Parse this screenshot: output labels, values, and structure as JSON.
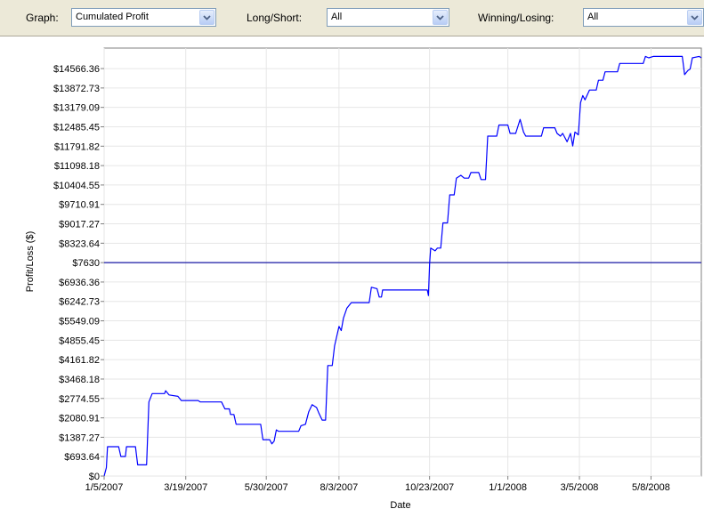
{
  "toolbar": {
    "graph_label": "Graph:",
    "graph_value": "Cumulated Profit",
    "longshort_label": "Long/Short:",
    "longshort_value": "All",
    "winlose_label": "Winning/Losing:",
    "winlose_value": "All",
    "dropdown_icon": "chevron-down-icon"
  },
  "chart_data": {
    "type": "line",
    "xlabel": "Date",
    "ylabel": "Profit/Loss ($)",
    "y_ticks": [
      "$0",
      "$693.64",
      "$1387.27",
      "$2080.91",
      "$2774.55",
      "$3468.18",
      "$4161.82",
      "$4855.45",
      "$5549.09",
      "$6242.73",
      "$6936.36",
      "$7630",
      "$8323.64",
      "$9017.27",
      "$9710.91",
      "$10404.55",
      "$11098.18",
      "$11791.82",
      "$12485.45",
      "$13179.09",
      "$13872.73",
      "$14566.36"
    ],
    "y_tick_values": [
      0,
      693.64,
      1387.27,
      2080.91,
      2774.55,
      3468.18,
      4161.82,
      4855.45,
      5549.09,
      6242.73,
      6936.36,
      7630,
      8323.64,
      9017.27,
      9710.91,
      10404.55,
      11098.18,
      11791.82,
      12485.45,
      13179.09,
      13872.73,
      14566.36
    ],
    "ylim": [
      0,
      15300
    ],
    "x_ticks": [
      "1/5/2007",
      "3/19/2007",
      "5/30/2007",
      "8/3/2007",
      "10/23/2007",
      "1/1/2008",
      "3/5/2008",
      "5/8/2008"
    ],
    "x_tick_values": [
      "2007-01-05",
      "2007-03-19",
      "2007-05-30",
      "2007-08-03",
      "2007-10-23",
      "2008-01-01",
      "2008-03-05",
      "2008-05-08"
    ],
    "xlim": [
      "2007-01-05",
      "2008-06-22"
    ],
    "reference_line": 7630,
    "line_color": "#0000ff",
    "grid": true,
    "series": [
      {
        "points": [
          [
            "2007-01-05",
            0
          ],
          [
            "2007-01-07",
            300
          ],
          [
            "2007-01-08",
            1050
          ],
          [
            "2007-01-18",
            1050
          ],
          [
            "2007-01-20",
            700
          ],
          [
            "2007-01-24",
            700
          ],
          [
            "2007-01-25",
            1050
          ],
          [
            "2007-02-02",
            1050
          ],
          [
            "2007-02-04",
            400
          ],
          [
            "2007-02-12",
            400
          ],
          [
            "2007-02-14",
            2650
          ],
          [
            "2007-02-17",
            2950
          ],
          [
            "2007-02-28",
            2950
          ],
          [
            "2007-03-01",
            3050
          ],
          [
            "2007-03-04",
            2900
          ],
          [
            "2007-03-12",
            2850
          ],
          [
            "2007-03-15",
            2700
          ],
          [
            "2007-03-30",
            2700
          ],
          [
            "2007-04-01",
            2650
          ],
          [
            "2007-04-20",
            2650
          ],
          [
            "2007-04-23",
            2400
          ],
          [
            "2007-04-27",
            2400
          ],
          [
            "2007-04-28",
            2200
          ],
          [
            "2007-05-01",
            2200
          ],
          [
            "2007-05-03",
            1850
          ],
          [
            "2007-05-25",
            1850
          ],
          [
            "2007-05-27",
            1300
          ],
          [
            "2007-06-02",
            1300
          ],
          [
            "2007-06-04",
            1150
          ],
          [
            "2007-06-06",
            1250
          ],
          [
            "2007-06-08",
            1650
          ],
          [
            "2007-06-10",
            1600
          ],
          [
            "2007-06-28",
            1600
          ],
          [
            "2007-06-30",
            1800
          ],
          [
            "2007-07-04",
            1850
          ],
          [
            "2007-07-07",
            2300
          ],
          [
            "2007-07-10",
            2550
          ],
          [
            "2007-07-14",
            2450
          ],
          [
            "2007-07-16",
            2250
          ],
          [
            "2007-07-19",
            2000
          ],
          [
            "2007-07-22",
            2000
          ],
          [
            "2007-07-24",
            3950
          ],
          [
            "2007-07-28",
            3950
          ],
          [
            "2007-07-30",
            4650
          ],
          [
            "2007-08-03",
            5350
          ],
          [
            "2007-08-05",
            5200
          ],
          [
            "2007-08-07",
            5650
          ],
          [
            "2007-08-10",
            6000
          ],
          [
            "2007-08-14",
            6200
          ],
          [
            "2007-08-30",
            6200
          ],
          [
            "2007-09-01",
            6750
          ],
          [
            "2007-09-06",
            6700
          ],
          [
            "2007-09-08",
            6400
          ],
          [
            "2007-09-10",
            6400
          ],
          [
            "2007-09-11",
            6650
          ],
          [
            "2007-10-21",
            6650
          ],
          [
            "2007-10-22",
            6450
          ],
          [
            "2007-10-23",
            7600
          ],
          [
            "2007-10-24",
            8150
          ],
          [
            "2007-10-28",
            8050
          ],
          [
            "2007-10-30",
            8150
          ],
          [
            "2007-11-02",
            8150
          ],
          [
            "2007-11-04",
            9050
          ],
          [
            "2007-11-08",
            9050
          ],
          [
            "2007-11-10",
            10050
          ],
          [
            "2007-11-14",
            10050
          ],
          [
            "2007-11-16",
            10650
          ],
          [
            "2007-11-20",
            10750
          ],
          [
            "2007-11-23",
            10650
          ],
          [
            "2007-11-27",
            10650
          ],
          [
            "2007-11-29",
            10850
          ],
          [
            "2007-12-06",
            10850
          ],
          [
            "2007-12-08",
            10600
          ],
          [
            "2007-12-12",
            10600
          ],
          [
            "2007-12-14",
            12150
          ],
          [
            "2007-12-22",
            12150
          ],
          [
            "2007-12-24",
            12550
          ],
          [
            "2008-01-01",
            12550
          ],
          [
            "2008-01-03",
            12250
          ],
          [
            "2008-01-08",
            12250
          ],
          [
            "2008-01-10",
            12500
          ],
          [
            "2008-01-12",
            12750
          ],
          [
            "2008-01-15",
            12300
          ],
          [
            "2008-01-17",
            12150
          ],
          [
            "2008-01-31",
            12150
          ],
          [
            "2008-02-02",
            12450
          ],
          [
            "2008-02-12",
            12450
          ],
          [
            "2008-02-14",
            12250
          ],
          [
            "2008-02-17",
            12150
          ],
          [
            "2008-02-19",
            12250
          ],
          [
            "2008-02-21",
            12100
          ],
          [
            "2008-02-23",
            11950
          ],
          [
            "2008-02-26",
            12250
          ],
          [
            "2008-02-28",
            11800
          ],
          [
            "2008-03-01",
            12300
          ],
          [
            "2008-03-04",
            12200
          ],
          [
            "2008-03-06",
            13350
          ],
          [
            "2008-03-08",
            13600
          ],
          [
            "2008-03-10",
            13450
          ],
          [
            "2008-03-14",
            13800
          ],
          [
            "2008-03-20",
            13800
          ],
          [
            "2008-03-22",
            14150
          ],
          [
            "2008-03-26",
            14150
          ],
          [
            "2008-03-28",
            14450
          ],
          [
            "2008-04-08",
            14450
          ],
          [
            "2008-04-10",
            14750
          ],
          [
            "2008-05-01",
            14750
          ],
          [
            "2008-05-03",
            15000
          ],
          [
            "2008-05-06",
            14950
          ],
          [
            "2008-05-10",
            15000
          ],
          [
            "2008-06-05",
            15000
          ],
          [
            "2008-06-07",
            14350
          ],
          [
            "2008-06-10",
            14500
          ],
          [
            "2008-06-12",
            14550
          ],
          [
            "2008-06-14",
            14950
          ],
          [
            "2008-06-20",
            15000
          ],
          [
            "2008-06-22",
            14950
          ]
        ]
      }
    ]
  }
}
